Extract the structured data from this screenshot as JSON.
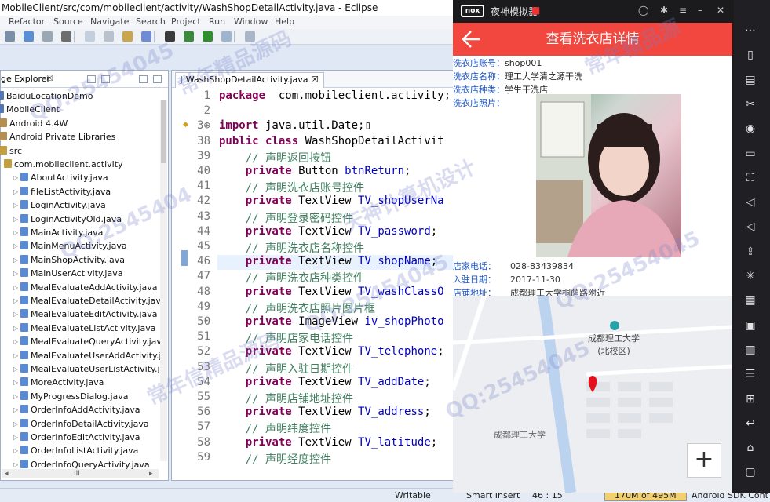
{
  "window": {
    "title": "MobileClient/src/com/mobileclient/activity/WashShopDetailActivity.java - Eclipse"
  },
  "menu": [
    "Refactor",
    "Source",
    "Navigate",
    "Search",
    "Project",
    "Run",
    "Window",
    "Help"
  ],
  "package_explorer": {
    "tab_label": "ge Explorer",
    "close": "☒",
    "items": [
      {
        "label": "BaiduLocationDemo",
        "level": 0,
        "icon": "project-icon"
      },
      {
        "label": "MobileClient",
        "level": 0,
        "icon": "project-icon"
      },
      {
        "label": "Android 4.4W",
        "level": 1,
        "icon": "library-icon"
      },
      {
        "label": "Android Private Libraries",
        "level": 1,
        "icon": "library-icon"
      },
      {
        "label": "src",
        "level": 1,
        "icon": "folder-icon"
      },
      {
        "label": "com.mobileclient.activity",
        "level": 2,
        "icon": "package-icon"
      },
      {
        "label": "AboutActivity.java",
        "level": 3,
        "icon": "java-file-icon"
      },
      {
        "label": "fileListActivity.java",
        "level": 3,
        "icon": "java-file-icon"
      },
      {
        "label": "LoginActivity.java",
        "level": 3,
        "icon": "java-file-icon"
      },
      {
        "label": "LoginActivityOld.java",
        "level": 3,
        "icon": "java-file-icon"
      },
      {
        "label": "MainActivity.java",
        "level": 3,
        "icon": "java-file-icon"
      },
      {
        "label": "MainMenuActivity.java",
        "level": 3,
        "icon": "java-file-icon"
      },
      {
        "label": "MainShopActivity.java",
        "level": 3,
        "icon": "java-file-icon"
      },
      {
        "label": "MainUserActivity.java",
        "level": 3,
        "icon": "java-file-icon"
      },
      {
        "label": "MealEvaluateAddActivity.java",
        "level": 3,
        "icon": "java-file-icon"
      },
      {
        "label": "MealEvaluateDetailActivity.java",
        "level": 3,
        "icon": "java-file-icon"
      },
      {
        "label": "MealEvaluateEditActivity.java",
        "level": 3,
        "icon": "java-file-icon"
      },
      {
        "label": "MealEvaluateListActivity.java",
        "level": 3,
        "icon": "java-file-icon"
      },
      {
        "label": "MealEvaluateQueryActivity.java",
        "level": 3,
        "icon": "java-file-icon"
      },
      {
        "label": "MealEvaluateUserAddActivity.j",
        "level": 3,
        "icon": "java-file-icon"
      },
      {
        "label": "MealEvaluateUserListActivity.j",
        "level": 3,
        "icon": "java-file-icon"
      },
      {
        "label": "MoreActivity.java",
        "level": 3,
        "icon": "java-file-icon"
      },
      {
        "label": "MyProgressDialog.java",
        "level": 3,
        "icon": "java-file-icon"
      },
      {
        "label": "OrderInfoAddActivity.java",
        "level": 3,
        "icon": "java-file-icon"
      },
      {
        "label": "OrderInfoDetailActivity.java",
        "level": 3,
        "icon": "java-file-icon"
      },
      {
        "label": "OrderInfoEditActivity.java",
        "level": 3,
        "icon": "java-file-icon"
      },
      {
        "label": "OrderInfoListActivity.java",
        "level": 3,
        "icon": "java-file-icon"
      },
      {
        "label": "OrderInfoQueryActivity.java",
        "level": 3,
        "icon": "java-file-icon"
      }
    ]
  },
  "editor": {
    "tab_label": "WashShopDetailActivity.java",
    "lines": [
      {
        "n": "1",
        "parts": [
          [
            "kw",
            "package"
          ],
          [
            "",
            "  com.mobileclient.activity;"
          ]
        ]
      },
      {
        "n": "2",
        "parts": []
      },
      {
        "n": "3⊕",
        "parts": [
          [
            "kw",
            "import"
          ],
          [
            "",
            " java.util.Date;"
          ],
          [
            "",
            "▯"
          ]
        ]
      },
      {
        "n": "38",
        "parts": [
          [
            "kw",
            "public class"
          ],
          [
            "",
            " WashShopDetailActivit"
          ]
        ]
      },
      {
        "n": "39",
        "parts": [
          [
            "",
            "    "
          ],
          [
            "cm",
            "// 声明返回按钮"
          ]
        ]
      },
      {
        "n": "40",
        "parts": [
          [
            "",
            "    "
          ],
          [
            "kw",
            "private"
          ],
          [
            "",
            " Button "
          ],
          [
            "fd",
            "btnReturn"
          ],
          [
            "",
            ";"
          ]
        ]
      },
      {
        "n": "41",
        "parts": [
          [
            "",
            "    "
          ],
          [
            "cm",
            "// 声明洗衣店账号控件"
          ]
        ]
      },
      {
        "n": "42",
        "parts": [
          [
            "",
            "    "
          ],
          [
            "kw",
            "private"
          ],
          [
            "",
            " TextView "
          ],
          [
            "fd",
            "TV_shopUserNa"
          ]
        ]
      },
      {
        "n": "43",
        "parts": [
          [
            "",
            "    "
          ],
          [
            "cm",
            "// 声明登录密码控件"
          ]
        ]
      },
      {
        "n": "44",
        "parts": [
          [
            "",
            "    "
          ],
          [
            "kw",
            "private"
          ],
          [
            "",
            " TextView "
          ],
          [
            "fd",
            "TV_password"
          ],
          [
            "",
            ";"
          ]
        ]
      },
      {
        "n": "45",
        "parts": [
          [
            "",
            "    "
          ],
          [
            "cm",
            "// 声明洗衣店名称控件"
          ]
        ]
      },
      {
        "n": "46",
        "parts": [
          [
            "",
            "    "
          ],
          [
            "kw",
            "private"
          ],
          [
            "",
            " TextView "
          ],
          [
            "fd",
            "TV_shopName"
          ],
          [
            "",
            ";"
          ]
        ]
      },
      {
        "n": "47",
        "parts": [
          [
            "",
            "    "
          ],
          [
            "cm",
            "// 声明洗衣店种类控件"
          ]
        ]
      },
      {
        "n": "48",
        "parts": [
          [
            "",
            "    "
          ],
          [
            "kw",
            "private"
          ],
          [
            "",
            " TextView "
          ],
          [
            "fd",
            "TV_washClassO"
          ]
        ]
      },
      {
        "n": "49",
        "parts": [
          [
            "",
            "    "
          ],
          [
            "cm",
            "// 声明洗衣店照片图片框"
          ]
        ]
      },
      {
        "n": "50",
        "parts": [
          [
            "",
            "    "
          ],
          [
            "kw",
            "private"
          ],
          [
            "",
            " ImageView "
          ],
          [
            "fd",
            "iv_shopPhoto"
          ]
        ]
      },
      {
        "n": "51",
        "parts": [
          [
            "",
            "    "
          ],
          [
            "cm",
            "// 声明店家电话控件"
          ]
        ]
      },
      {
        "n": "52",
        "parts": [
          [
            "",
            "    "
          ],
          [
            "kw",
            "private"
          ],
          [
            "",
            " TextView "
          ],
          [
            "fd",
            "TV_telephone"
          ],
          [
            "",
            ";"
          ]
        ]
      },
      {
        "n": "53",
        "parts": [
          [
            "",
            "    "
          ],
          [
            "cm",
            "// 声明入驻日期控件"
          ]
        ]
      },
      {
        "n": "54",
        "parts": [
          [
            "",
            "    "
          ],
          [
            "kw",
            "private"
          ],
          [
            "",
            " TextView "
          ],
          [
            "fd",
            "TV_addDate"
          ],
          [
            "",
            ";"
          ]
        ]
      },
      {
        "n": "55",
        "parts": [
          [
            "",
            "    "
          ],
          [
            "cm",
            "// 声明店铺地址控件"
          ]
        ]
      },
      {
        "n": "56",
        "parts": [
          [
            "",
            "    "
          ],
          [
            "kw",
            "private"
          ],
          [
            "",
            " TextView "
          ],
          [
            "fd",
            "TV_address"
          ],
          [
            "",
            ";"
          ]
        ]
      },
      {
        "n": "57",
        "parts": [
          [
            "",
            "    "
          ],
          [
            "cm",
            "// 声明纬度控件"
          ]
        ]
      },
      {
        "n": "58",
        "parts": [
          [
            "",
            "    "
          ],
          [
            "kw",
            "private"
          ],
          [
            "",
            " TextView "
          ],
          [
            "fd",
            "TV_latitude"
          ],
          [
            "",
            ";"
          ]
        ]
      },
      {
        "n": "59",
        "parts": [
          [
            "",
            "    "
          ],
          [
            "cm",
            "// 声明经度控件"
          ]
        ]
      }
    ]
  },
  "status": {
    "writable": "Writable",
    "insert": "Smart Insert",
    "position": "46 : 15",
    "memory": "170M of 495M",
    "sdk": "Android SDK Cont"
  },
  "emulator": {
    "brand": "nox",
    "title": "夜神模拟器",
    "app_title": "查看洗衣店详情",
    "fields": [
      {
        "label": "洗衣店账号：",
        "value": "shop001"
      },
      {
        "label": "洗衣店名称：",
        "value": "理工大学清之源干洗"
      },
      {
        "label": "洗衣店种类：",
        "value": "学生干洗店"
      },
      {
        "label": "洗衣店照片：",
        "value": ""
      }
    ],
    "fields2": [
      {
        "label": "店家电话：",
        "value": "028-83439834"
      },
      {
        "label": "入驻日期：",
        "value": "2017-11-30"
      },
      {
        "label": "店铺地址：",
        "value": "成都理工大学桐荫路附近"
      }
    ],
    "map_labels": {
      "campus": "成都理工大学",
      "campus_sub": "(北校区)",
      "south": "成都理工大学"
    },
    "zoom_button": "+"
  },
  "watermarks": [
    "QQ:25454045",
    "常年精品源码",
    "天神计算机设计",
    "QQ:2545404",
    "常年信精品源码",
    "QQ:25454045",
    "QQ:25454045",
    "常年精品源",
    "QQ:25454045"
  ]
}
